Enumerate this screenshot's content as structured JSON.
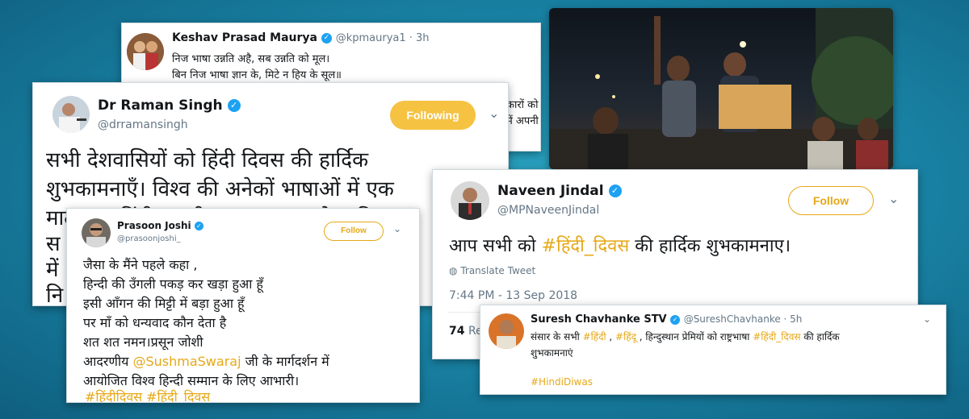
{
  "colors": {
    "hashtag": "#e6a817",
    "verified": "#1da1f2",
    "following_bg": "#f5c242"
  },
  "card_keshav": {
    "name": "Keshav Prasad Maurya",
    "handle": "@kpmaurya1 · 3h",
    "lines": [
      "निज भाषा उन्नति अहै, सब उन्नति को मूल।",
      "बिन निज भाषा ज्ञान के, मिटे न हिय के सूल॥"
    ],
    "partial_lines": [
      "कारों को",
      "में अपनी"
    ]
  },
  "card_raman": {
    "name": "Dr Raman Singh",
    "handle": "@drramansingh",
    "follow_label": "Following",
    "lines": [
      "सभी देशवासियों को हिंदी दिवस की हार्दिक",
      "शुभकामनाएँ। विश्व की अनेकों भाषाओं में एक",
      "मातृभाषा हिंदी अपनी सरलता व अपने साहित्य",
      "स",
      "में",
      "नि"
    ]
  },
  "card_naveen": {
    "name": "Naveen Jindal",
    "handle": "@MPNaveenJindal",
    "follow_label": "Follow",
    "text_pre": "आप सभी को ",
    "hashtag": "#हिंदी_दिवस",
    "text_post": " की हार्दिक शुभकामनाए।",
    "translate": "Translate Tweet",
    "timestamp": "7:44 PM - 13 Sep 2018",
    "retweets_count": "74",
    "retweets_label": "Ret"
  },
  "card_prasoon": {
    "name": "Prasoon Joshi",
    "handle": "@prasoonjoshi_",
    "follow_label": "Follow",
    "lines": [
      "जैसा के मैंने पहले कहा ,",
      "हिन्दी की उँगली पकड़ कर खड़ा हुआ हूँ",
      "इसी आँगन की मिट्टी में बड़ा हुआ हूँ",
      "पर माँ को धन्यवाद कौन देता है",
      "शत शत नमन।प्रसून जोशी"
    ],
    "line6_pre": "आदरणीय ",
    "mention": "@SushmaSwaraj",
    "line6_post": " जी के मार्गदर्शन में",
    "line7": "आयोजित विश्व हिन्दी सम्मान के लिए आभारी।",
    "hashtags": "#हिंदीदिवस #हिंदी_दिवस"
  },
  "card_suresh": {
    "name": "Suresh Chavhanke STV",
    "handle": "@SureshChavhanke · 5h",
    "line1_a": "संसार के सभी ",
    "tag1": "#हिंदी",
    "line1_b": " , ",
    "tag2": "#हिंदू",
    "line1_c": " , हिन्दुस्थान प्रेमियों को राष्ट्रभाषा ",
    "tag3": "#हिंदी_दिवस",
    "line1_d": " की हार्दिक",
    "line2": "शुभकामनाएं",
    "hashtag_line": "#HindiDiwas"
  },
  "photo": {
    "description_icon": "protest-photo"
  }
}
